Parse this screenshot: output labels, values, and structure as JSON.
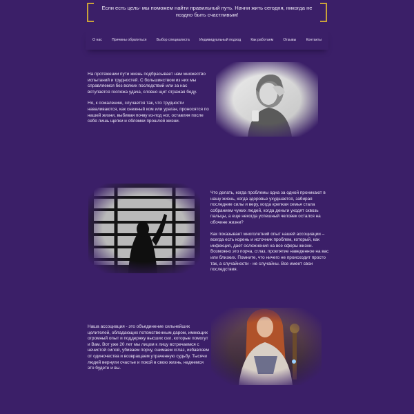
{
  "banner": {
    "tagline": "Если есть цель- мы поможем найти правильный путь. Начни жить сегодня, никогда не поздно быть счастливым!"
  },
  "nav": {
    "items": [
      "О нас",
      "Причины обратиться",
      "Выбор специалиста",
      "Индивидуальный подход",
      "Как работаем",
      "Отзывы",
      "Контакты"
    ]
  },
  "sections": [
    {
      "paragraphs": [
        "На протяжении пути жизнь подбрасывает нам множество испытаний и трудностей. С большинством из них мы справляемся без всяких последствий или за нас вступается госпожа удача, словно щит отражая беду.",
        "Но, к сожалению, случается так, что трудности наваливаются, как снежный ком или ураган, проносятся по нашей жизни, выбивая почву из-под ног, оставляя после себя лишь щепки и обломки прошлой жизни."
      ]
    },
    {
      "paragraphs": [
        "Что делать, когда проблемы одна за одной проникают в нашу жизнь, когда здоровье ухудшается, забирая последние силы и веру, когда крепкая семья стала собранием чужих людей, когда деньги уходят сквозь пальцы, а еще некогда успешный человек остался на обочине жизни?",
        "Как показывает многолетний опыт нашей ассоциации – всегда есть корень и источник проблем, который, как инфекция, дает осложнения на все сферы жизни. Возможно это порча, сглаз, проклятие наведенное на вас или близких. Помните, что ничего не происходит просто так, а случайности - не случайны. Все имеет свои последствия."
      ]
    },
    {
      "paragraphs": [
        "Наша ассоциация - это объединение сильнейших целителей, обладающих потомственным даром, имеющих огромный опыт и поддержку высших сил, которые помогут и Вам. Вот уже 20 лет мы лицом к лицу встречаемся с нечистой силой, убиваем порчу, снимаем сглаз, избавляем от одиночества и возвращаем утраченную судьбу. Тысячи людей вернули счастье и покой в свою жизнь, надеемся это будете и вы."
      ]
    }
  ],
  "colors": {
    "background": "#3b1f68",
    "accent_gold": "#c9a23a",
    "text": "#ece6f6"
  }
}
